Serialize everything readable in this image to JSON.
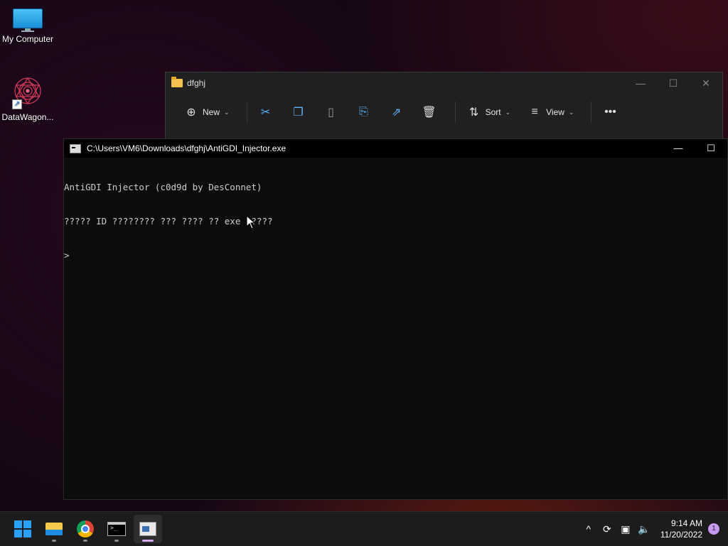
{
  "desktop": {
    "icons": [
      {
        "label": "My Computer"
      },
      {
        "label": "DataWagon..."
      }
    ]
  },
  "explorer": {
    "title": "dfghj",
    "toolbar": {
      "new_label": "New",
      "sort_label": "Sort",
      "view_label": "View"
    }
  },
  "console": {
    "title": "C:\\Users\\VM6\\Downloads\\dfghj\\AntiGDI_Injector.exe",
    "lines": [
      "AntiGDI Injector (c0d9d by DesConnet)",
      "????? ID ???????? ??? ???? ?? exe ?????",
      ">"
    ]
  },
  "taskbar": {
    "time": "9:14 AM",
    "date": "11/20/2022",
    "notification_count": "1"
  },
  "colors": {
    "accent": "#2aa0ff",
    "console_bg": "#0c0c0c",
    "console_text": "#cccccc",
    "explorer_bg": "#202020",
    "taskbar_bg": "#1c1c1c"
  }
}
